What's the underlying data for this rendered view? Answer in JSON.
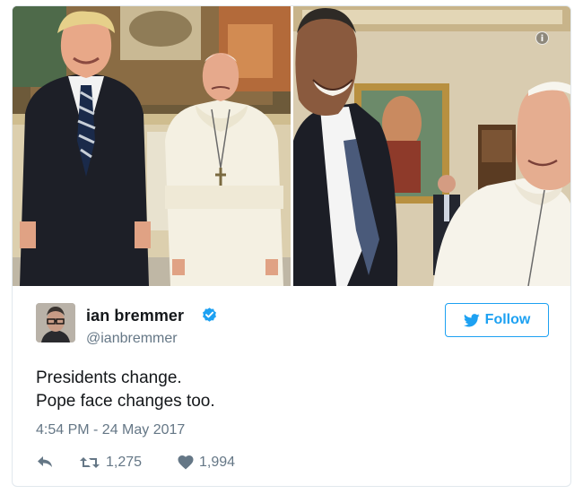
{
  "media": {
    "info_icon": "info-icon"
  },
  "tweet": {
    "user_name": "ian bremmer",
    "handle": "@ianbremmer",
    "verified_icon": "verified-badge-icon",
    "follow_label": "Follow",
    "text_lines": [
      "Presidents change.",
      "Pope face changes too."
    ],
    "timestamp": "4:54 PM - 24 May 2017",
    "retweets": "1,275",
    "likes": "1,994"
  },
  "colors": {
    "accent": "#1da1f2",
    "text": "#14171a",
    "muted": "#657786",
    "border": "#e1e8ed"
  }
}
